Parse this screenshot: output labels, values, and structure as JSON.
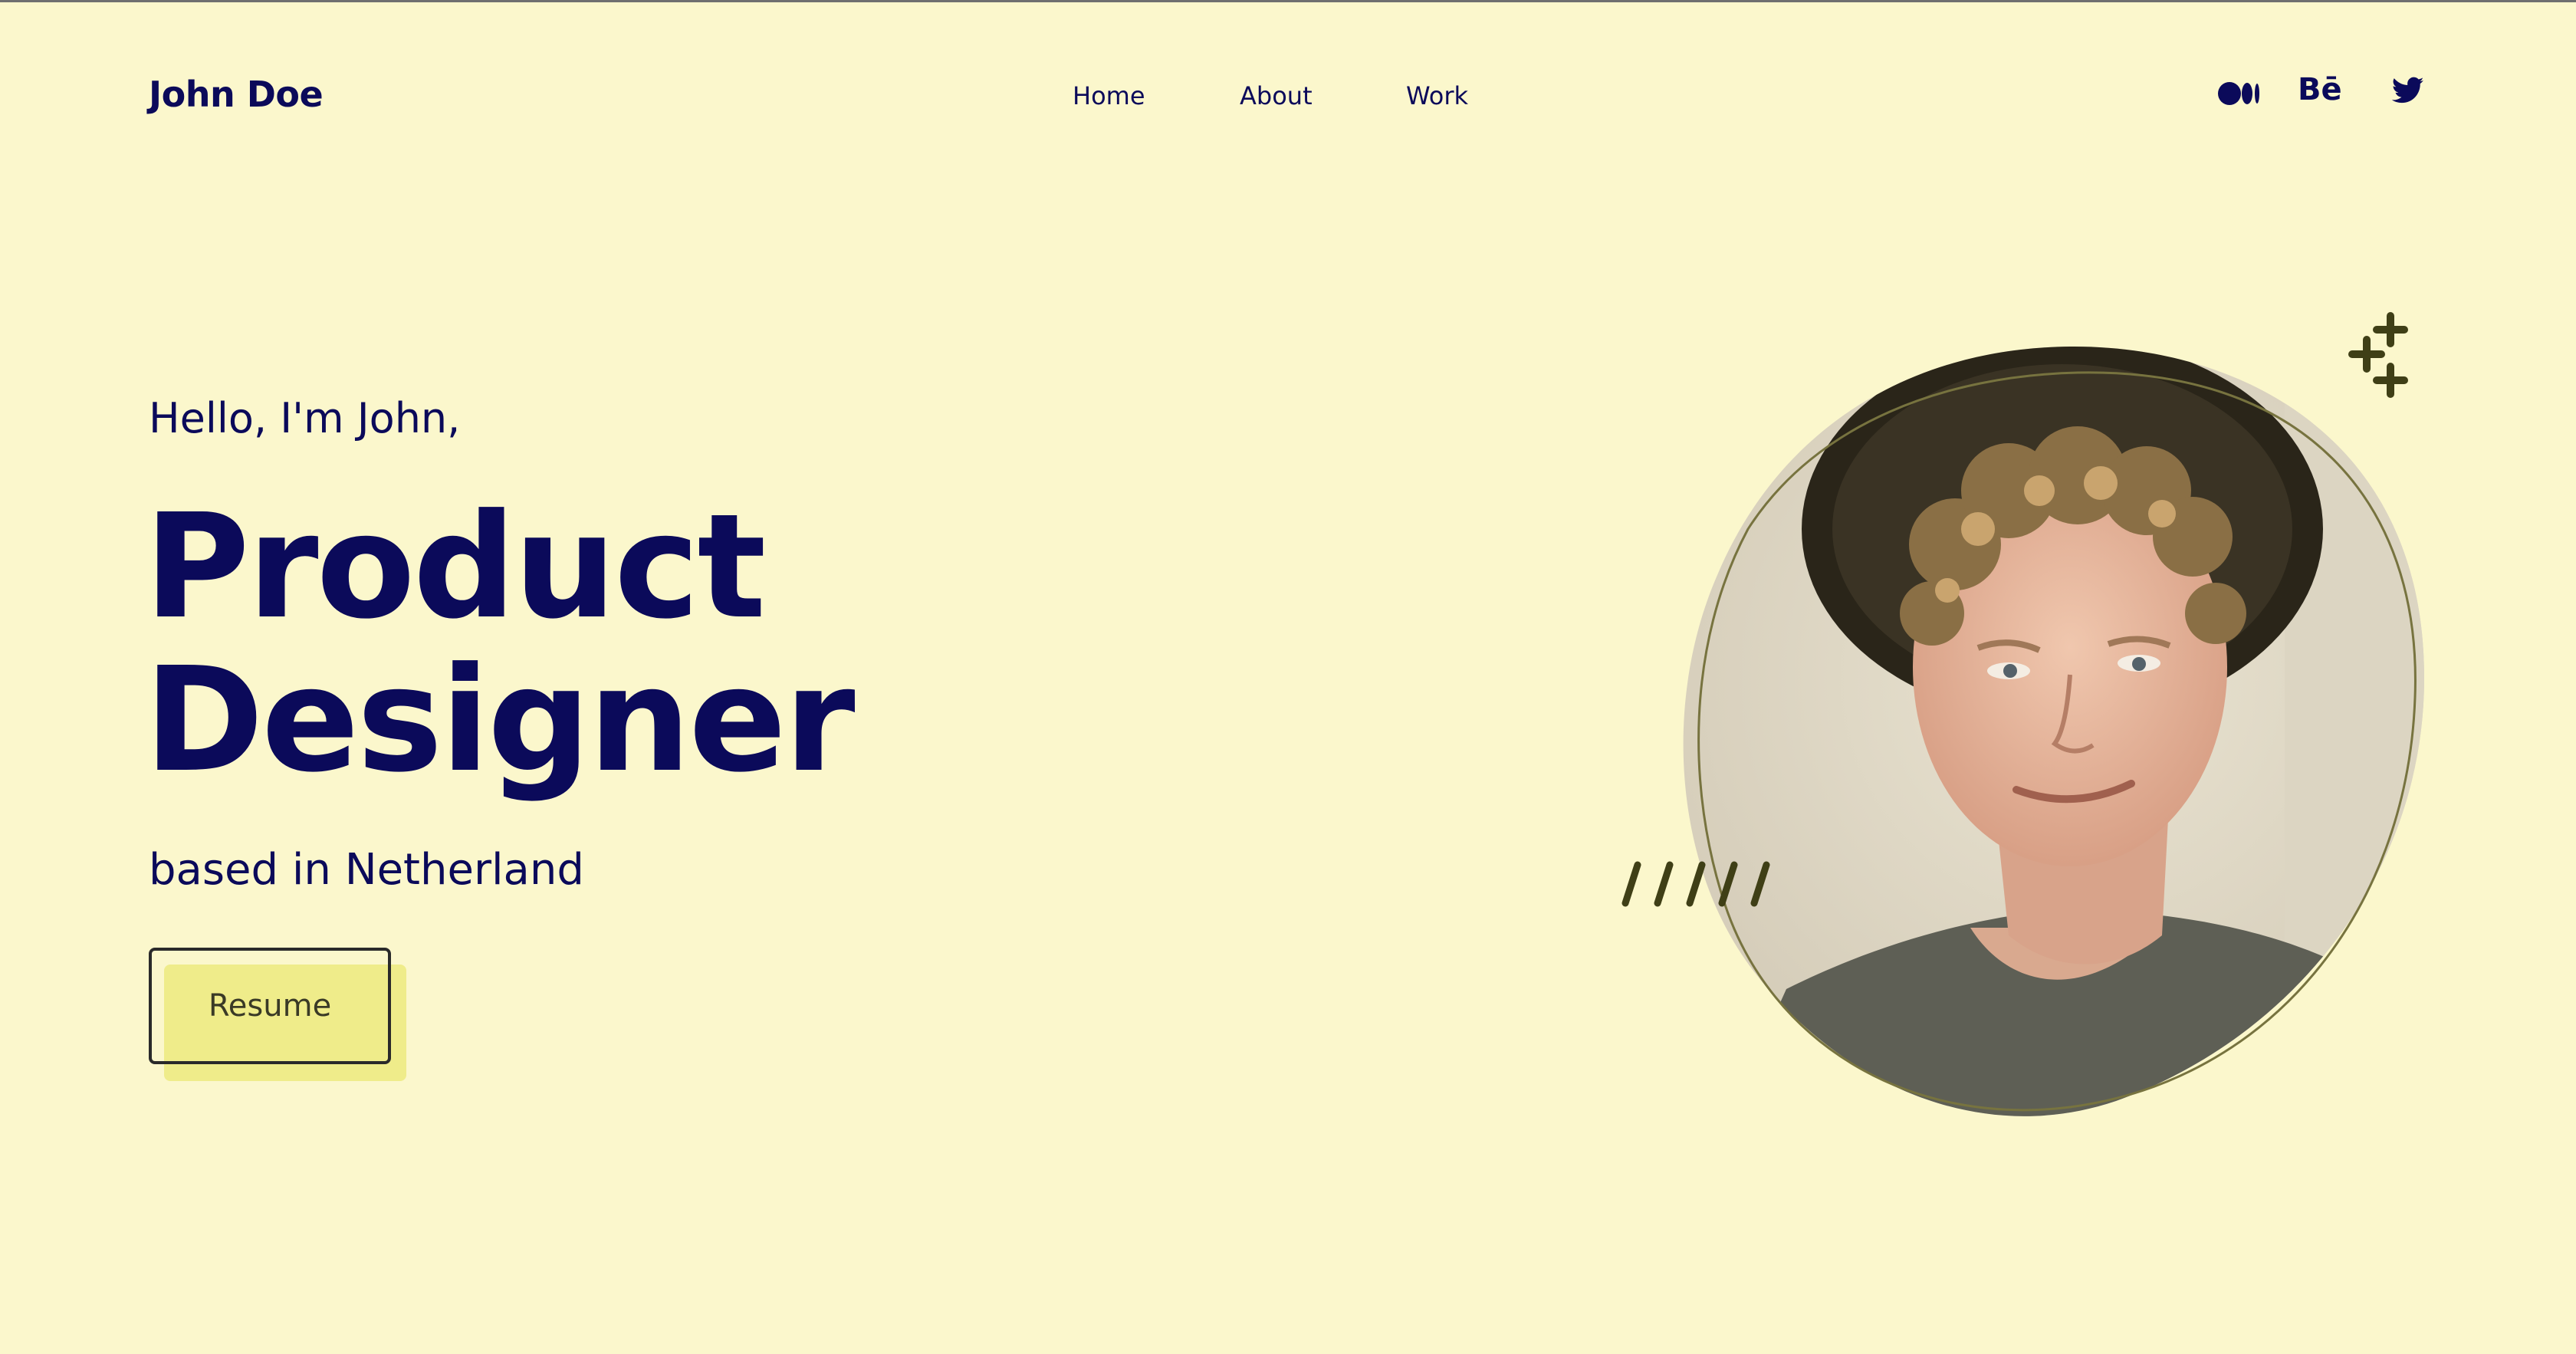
{
  "header": {
    "logo": "John Doe",
    "nav": [
      {
        "label": "Home"
      },
      {
        "label": "About"
      },
      {
        "label": "Work"
      }
    ],
    "social": [
      {
        "icon": "medium-icon"
      },
      {
        "icon": "behance-icon",
        "glyph": "Bē"
      },
      {
        "icon": "twitter-icon"
      }
    ]
  },
  "hero": {
    "greeting": "Hello, I'm John,",
    "title_line1": "Product",
    "title_line2": "Designer",
    "location": "based in Netherland",
    "resume_label": "Resume"
  },
  "colors": {
    "background": "#FBF7CC",
    "text": "#0B0A5A",
    "accent": "#EFEC8A",
    "decor": "#3F3F16"
  }
}
